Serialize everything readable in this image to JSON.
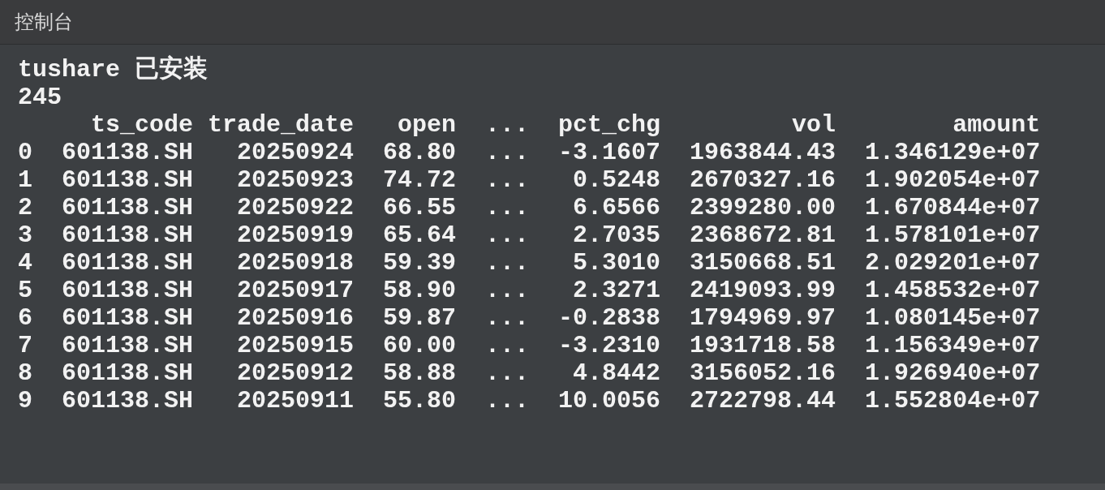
{
  "panel": {
    "title": "控制台"
  },
  "console": {
    "lines": [
      "tushare 已安装",
      "245"
    ],
    "table": {
      "columns": [
        "",
        "ts_code",
        "trade_date",
        "open",
        "...",
        "pct_chg",
        "vol",
        "amount"
      ],
      "rows": [
        [
          "0",
          "601138.SH",
          "20250924",
          "68.80",
          "...",
          "-3.1607",
          "1963844.43",
          "1.346129e+07"
        ],
        [
          "1",
          "601138.SH",
          "20250923",
          "74.72",
          "...",
          "0.5248",
          "2670327.16",
          "1.902054e+07"
        ],
        [
          "2",
          "601138.SH",
          "20250922",
          "66.55",
          "...",
          "6.6566",
          "2399280.00",
          "1.670844e+07"
        ],
        [
          "3",
          "601138.SH",
          "20250919",
          "65.64",
          "...",
          "2.7035",
          "2368672.81",
          "1.578101e+07"
        ],
        [
          "4",
          "601138.SH",
          "20250918",
          "59.39",
          "...",
          "5.3010",
          "3150668.51",
          "2.029201e+07"
        ],
        [
          "5",
          "601138.SH",
          "20250917",
          "58.90",
          "...",
          "2.3271",
          "2419093.99",
          "1.458532e+07"
        ],
        [
          "6",
          "601138.SH",
          "20250916",
          "59.87",
          "...",
          "-0.2838",
          "1794969.97",
          "1.080145e+07"
        ],
        [
          "7",
          "601138.SH",
          "20250915",
          "60.00",
          "...",
          "-3.2310",
          "1931718.58",
          "1.156349e+07"
        ],
        [
          "8",
          "601138.SH",
          "20250912",
          "58.88",
          "...",
          "4.8442",
          "3156052.16",
          "1.926940e+07"
        ],
        [
          "9",
          "601138.SH",
          "20250911",
          "55.80",
          "...",
          "10.0056",
          "2722798.44",
          "1.552804e+07"
        ]
      ]
    }
  }
}
